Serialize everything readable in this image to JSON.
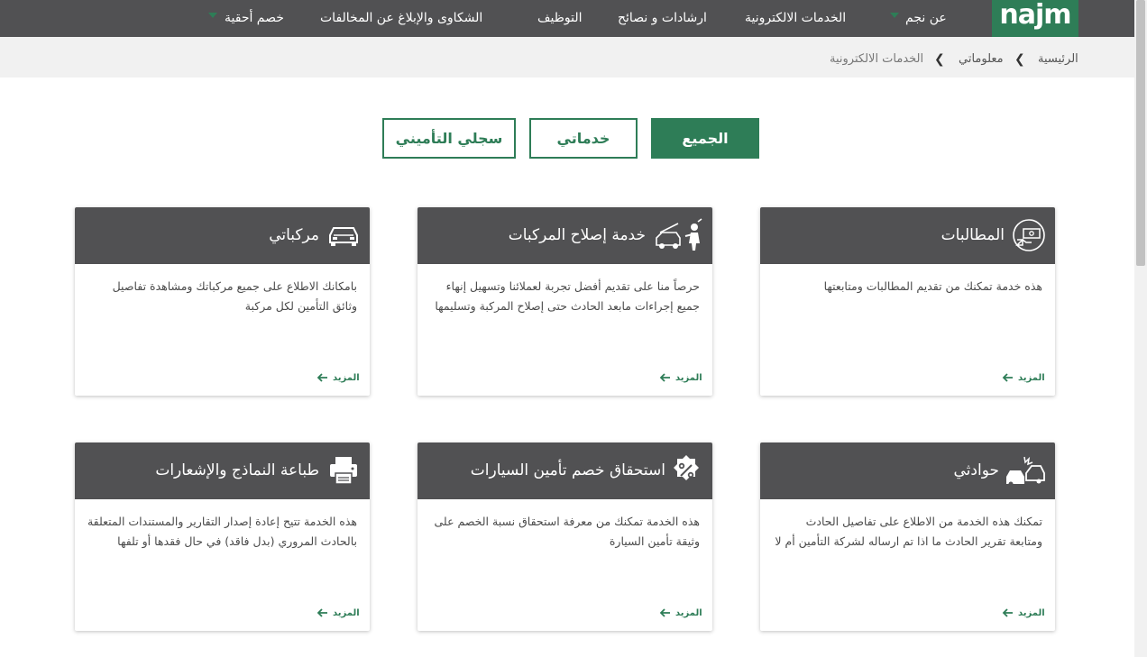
{
  "header": {
    "logo_text": "najm",
    "nav": [
      {
        "label": "عن نجم",
        "has_dropdown": true
      },
      {
        "label": "الخدمات الالكترونية",
        "has_dropdown": false
      },
      {
        "label": "ارشادات و نصائح",
        "has_dropdown": false
      },
      {
        "label": "التوظيف",
        "has_dropdown": false
      },
      {
        "label": "الشكاوى والإبلاغ عن المخالفات",
        "has_dropdown": false
      },
      {
        "label": "خصم أحقية",
        "has_dropdown": true
      }
    ]
  },
  "breadcrumb": {
    "items": [
      "الرئيسية",
      "معلوماتي",
      "الخدمات الالكترونية"
    ]
  },
  "filters": {
    "all": "الجميع",
    "my_services": "خدماتي",
    "insurance_record": "سجلي التأميني"
  },
  "cards": [
    {
      "title": "المطالبات",
      "icon": "claims-icon",
      "desc": "هذه خدمة تمكنك من تقديم المطالبات ومتابعتها",
      "more": "المزيد"
    },
    {
      "title": "خدمة إصلاح المركبات",
      "icon": "car-repair-icon",
      "desc": "حرصاً منا على تقديم أفضل تجربة لعملائنا وتسهيل إنهاء جميع إجراءات مابعد الحادث حتى إصلاح المركبة وتسليمها",
      "more": "المزيد"
    },
    {
      "title": "مركباتي",
      "icon": "car-icon",
      "desc": "بامكانك الاطلاع على جميع مركباتك ومشاهدة تفاصيل وثائق التأمين لكل مركبة",
      "more": "المزيد"
    },
    {
      "title": "حوادثي",
      "icon": "accident-icon",
      "desc": "تمكنك هذه الخدمة من الاطلاع على تفاصيل الحادث ومتابعة تقرير الحادث ما اذا تم ارساله لشركة التأمين أم لا",
      "more": "المزيد"
    },
    {
      "title": "استحقاق خصم تأمين السيارات",
      "icon": "discount-percent-icon",
      "desc": "هذه الخدمة تمكنك من معرفة استحقاق نسبة الخصم على وثيقة تأمين السيارة",
      "more": "المزيد"
    },
    {
      "title": "طباعة النماذج والإشعارات",
      "icon": "printer-icon",
      "desc": "هذه الخدمة تتيح إعادة إصدار التقارير والمستندات المتعلقة بالحادث المروري (بدل فاقد) في حال فقدها أو تلفها",
      "more": "المزيد"
    }
  ],
  "colors": {
    "brand_green": "#2e7d57",
    "header_gray": "#515153"
  }
}
